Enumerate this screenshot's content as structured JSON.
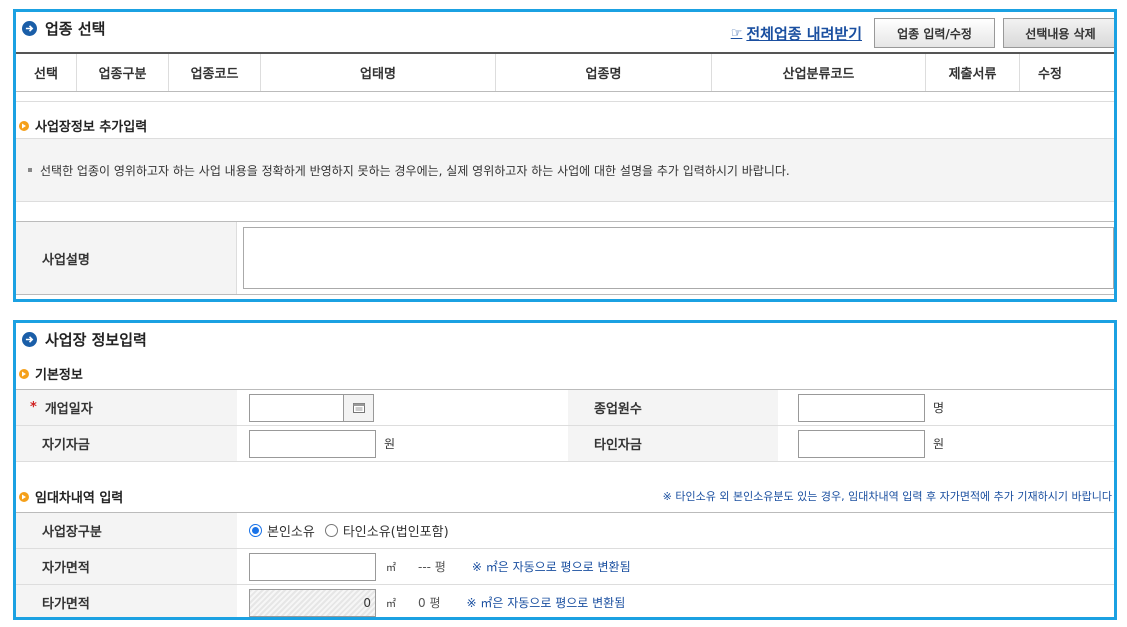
{
  "industry": {
    "title": "업종 선택",
    "download_link": "전체업종 내려받기",
    "edit_button": "업종 입력/수정",
    "delete_button": "선택내용 삭제",
    "columns": [
      "선택",
      "업종구분",
      "업종코드",
      "업태명",
      "업종명",
      "산업분류코드",
      "제출서류",
      "수정"
    ]
  },
  "workplace_extra": {
    "title": "사업장정보 추가입력",
    "notice": "선택한 업종이 영위하고자 하는 사업 내용을 정확하게 반영하지 못하는 경우에는, 실제 영위하고자 하는 사업에 대한 설명을 추가 입력하시기 바랍니다.",
    "description_label": "사업설명"
  },
  "workplace_info": {
    "title": "사업장 정보입력",
    "basic": {
      "title": "기본정보",
      "required_mark": "*",
      "open_date_label": "개업일자",
      "employees_label": "종업원수",
      "employees_unit": "명",
      "own_capital_label": "자기자금",
      "own_capital_unit": "원",
      "other_capital_label": "타인자금",
      "other_capital_unit": "원"
    },
    "lease": {
      "title": "임대차내역 입력",
      "note": "※ 타인소유 외 본인소유분도 있는 경우, 임대차내역 입력 후 자가면적에 추가 기재하시기 바랍니다",
      "type_label": "사업장구분",
      "option_own": "본인소유",
      "option_other": "타인소유(법인포함)",
      "own_area_label": "자가면적",
      "own_area_unit": "㎡",
      "own_area_pyeong": "--- 평",
      "own_area_hint": "※ ㎡은 자동으로 평으로 변환됨",
      "other_area_label": "타가면적",
      "other_area_value": "0",
      "other_area_unit": "㎡",
      "other_area_pyeong": "0 평",
      "other_area_hint": "※ ㎡은 자동으로 평으로 변환됨"
    }
  },
  "icons": {
    "section": "arrow-circle-icon",
    "subsection": "orange-arrow-icon",
    "download": "hand-pointer-icon",
    "calendar": "calendar-icon"
  },
  "colors": {
    "panel_border": "#1ba1e2",
    "link": "#1a4fa0",
    "required": "#d02020",
    "section_dot": "#1a5ea8",
    "subsection_dot": "#f5a01a"
  }
}
